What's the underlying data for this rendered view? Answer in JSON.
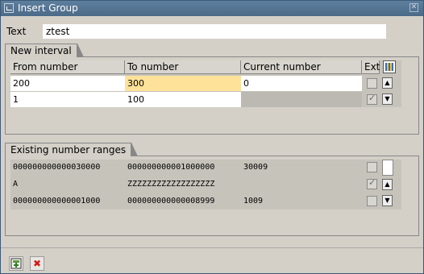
{
  "window": {
    "title": "Insert Group"
  },
  "text_field": {
    "label": "Text",
    "value": "ztest"
  },
  "new_interval": {
    "title": "New interval",
    "columns": [
      "From number",
      "To number",
      "Current number",
      "Ext"
    ],
    "rows": [
      {
        "from": "200",
        "to": "300",
        "current": "0",
        "ext": false
      },
      {
        "from": "1",
        "to": "100",
        "current": "",
        "ext": true
      }
    ]
  },
  "existing": {
    "title": "Existing number ranges",
    "rows": [
      {
        "from": "000000000000030000",
        "to": "000000000001000000",
        "current": "30009",
        "ext": false
      },
      {
        "from": "A",
        "to": "ZZZZZZZZZZZZZZZZZZ",
        "current": "",
        "ext": true
      },
      {
        "from": "000000000000001000",
        "to": "000000000000008999",
        "current": "1009",
        "ext": false
      }
    ]
  },
  "icons": {
    "title": "window-icon",
    "close": "close-icon",
    "save": "save-icon",
    "cancel": "cancel-icon"
  },
  "colors": {
    "titlebar": "#4f6e8d",
    "highlight": "#ffe29a",
    "cancel": "#d21a1a"
  }
}
